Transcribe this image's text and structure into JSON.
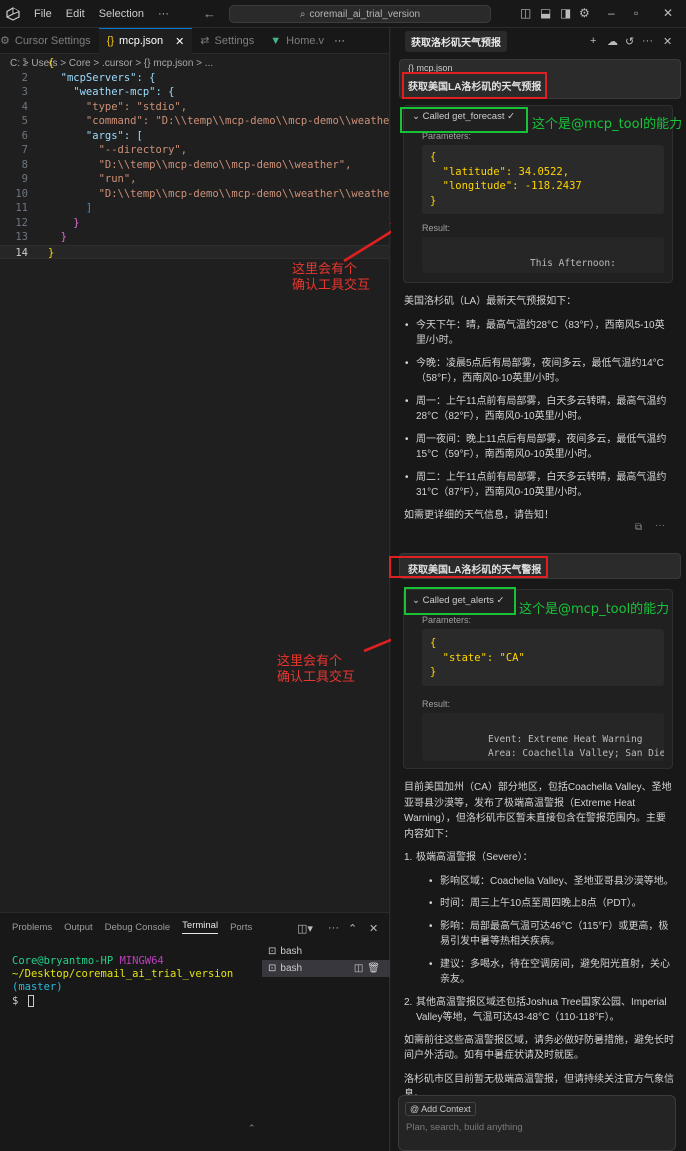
{
  "titlebar": {
    "menu": [
      "File",
      "Edit",
      "Selection",
      "···"
    ],
    "search": "coremail_ai_trial_version"
  },
  "editor": {
    "tabs": [
      {
        "label": "Cursor Settings",
        "icon": "gear-icon"
      },
      {
        "label": "mcp.json",
        "icon": "{}"
      },
      {
        "label": "Settings",
        "icon": "settings-icon"
      },
      {
        "label": "Home.v",
        "icon": "vue-icon"
      }
    ],
    "breadcrumb": "C: > Users > Core > .cursor > {} mcp.json > ...",
    "line_numbers": [
      "1",
      "2",
      "3",
      "4",
      "5",
      "6",
      "7",
      "8",
      "9",
      "10",
      "11",
      "12",
      "13",
      "14"
    ],
    "code_lines": [
      "{",
      "  \"mcpServers\": {",
      "    \"weather-mcp\": {",
      "      \"type\": \"stdio\",",
      "      \"command\": \"D:\\\\temp\\\\mcp-demo\\\\mcp-demo\\\\weather\\\\m",
      "      \"args\": [",
      "        \"--directory\",",
      "        \"D:\\\\temp\\\\mcp-demo\\\\mcp-demo\\\\weather\",",
      "        \"run\",",
      "        \"D:\\\\temp\\\\mcp-demo\\\\mcp-demo\\\\weather\\\\weather.",
      "      ]",
      "    }",
      "  }",
      "}"
    ]
  },
  "annotations": {
    "confirm_note": "这里会有个\n确认工具交互",
    "capability_note": "这个是@mcp_tool的能力"
  },
  "terminal": {
    "tabs": [
      "Problems",
      "Output",
      "Debug Console",
      "Terminal",
      "Ports"
    ],
    "user_host": "Core@bryantmo-HP",
    "shell": "MINGW64",
    "path": "~/Desktop/coremail_ai_trial_version",
    "branch": "(master)",
    "prompt": "$",
    "sessions": [
      "bash",
      "bash"
    ]
  },
  "chat": {
    "title": "获取洛杉矶天气预报",
    "messages": [
      {
        "context": "{} mcp.json",
        "query": "获取美国LA洛杉矶的天气预报",
        "tool": "Called get_forecast ✓",
        "params_label": "Parameters:",
        "params": "{\n  \"latitude\": 34.0522,\n  \"longitude\": -118.2437\n}",
        "result_label": "Result:",
        "result": "This Afternoon:"
      },
      {
        "query": "获取美国LA洛杉矶的天气警报",
        "tool": "Called get_alerts ✓",
        "params_label": "Parameters:",
        "params": "{\n  \"state\": \"CA\"\n}",
        "result_label": "Result:",
        "result": "Event: Extreme Heat Warning\nArea: Coachella Valley; San Diego"
      }
    ],
    "forecast": {
      "intro": "美国洛杉矶（LA）最新天气预报如下：",
      "items": [
        "今天下午：晴，最高气温约28°C（83°F），西南风5-10英里/小时。",
        "今晚：凌晨5点后有局部雾，夜间多云，最低气温约14°C（58°F），西南风0-10英里/小时。",
        "周一：上午11点前有局部雾，白天多云转晴，最高气温约28°C（82°F），西南风0-10英里/小时。",
        "周一夜间：晚上11点后有局部雾，夜间多云，最低气温约15°C（59°F），南西南风0-10英里/小时。",
        "周二：上午11点前有局部雾，白天多云转晴，最高气温约31°C（87°F），西南风0-10英里/小时。"
      ],
      "outro": "如需更详细的天气信息，请告知！"
    },
    "alerts": {
      "intro": "目前美国加州（CA）部分地区，包括Coachella Valley、圣地亚哥县沙漠等，发布了极端高温警报（Extreme Heat Warning），但洛杉矶市区暂未直接包含在警报范围内。主要内容如下：",
      "item1_title": "极端高温警报（Severe）：",
      "item1_sub": [
        "影响区域：Coachella Valley、圣地亚哥县沙漠等地。",
        "时间：周三上午10点至周四晚上8点（PDT）。",
        "影响：局部最高气温可达46°C（115°F）或更高，极易引发中暑等热相关疾病。",
        "建议：多喝水，待在空调房间，避免阳光直射，关心亲友。"
      ],
      "item2": "其他高温警报区域还包括Joshua Tree国家公园、Imperial Valley等地，气温可达43-48°C（110-118°F）。",
      "para1": "如需前往这些高温警报区域，请务必做好防暑措施，避免长时间户外活动。如有中暑症状请及时就医。",
      "para2": "洛杉矶市区目前暂无极端高温警报，但请持续关注官方气象信息。"
    },
    "composer": {
      "add_context": "@ Add Context",
      "placeholder": "Plan, search, build anything"
    }
  }
}
